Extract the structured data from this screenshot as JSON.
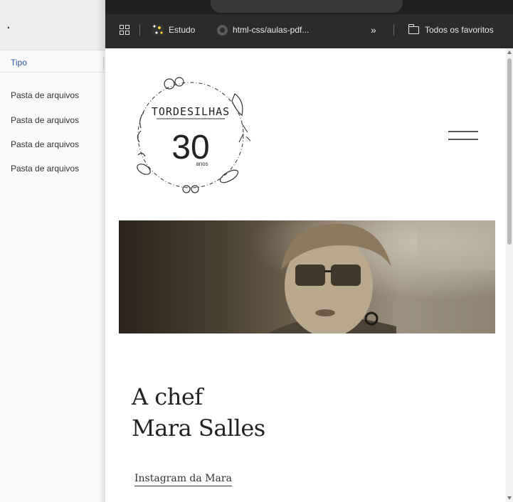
{
  "explorer": {
    "title_fragment": ".",
    "column_header": "Tipo",
    "rows": [
      "Pasta de arquivos",
      "Pasta de arquivos",
      "Pasta de arquivos",
      "Pasta de arquivos"
    ]
  },
  "bookmarks": {
    "items": [
      {
        "label": "Estudo",
        "icon": "estudo-icon"
      },
      {
        "label": "html-css/aulas-pdf...",
        "icon": "github-icon"
      }
    ],
    "overflow_label": "»",
    "all_bookmarks_label": "Todos os favoritos"
  },
  "page": {
    "logo": {
      "brand": "TORDESILHAS",
      "number": "30",
      "anos": "anos"
    },
    "chef_title_line1": "A chef",
    "chef_title_line2": "Mara Salles",
    "instagram_link": "Instagram da Mara"
  }
}
